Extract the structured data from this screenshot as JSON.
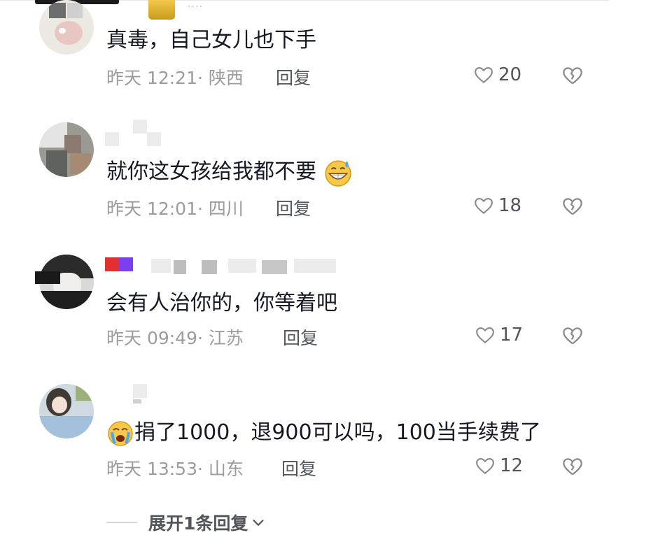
{
  "comments": [
    {
      "text": "真毒，自己女儿也下手",
      "time_location": "昨天 12:21· 陕西",
      "reply_label": "回复",
      "like_count": "20"
    },
    {
      "text": "就你这女孩给我都不要",
      "time_location": "昨天 12:01· 四川",
      "reply_label": "回复",
      "like_count": "18"
    },
    {
      "text": "会有人治你的，你等着吧",
      "time_location": "昨天 09:49· 江苏",
      "reply_label": "回复",
      "like_count": "17"
    },
    {
      "text": "捐了1000，退900可以吗，100当手续费了",
      "time_location": "昨天 13:53· 山东",
      "reply_label": "回复",
      "like_count": "12"
    }
  ],
  "expand_replies_label": "展开1条回复",
  "top_dots": "····"
}
